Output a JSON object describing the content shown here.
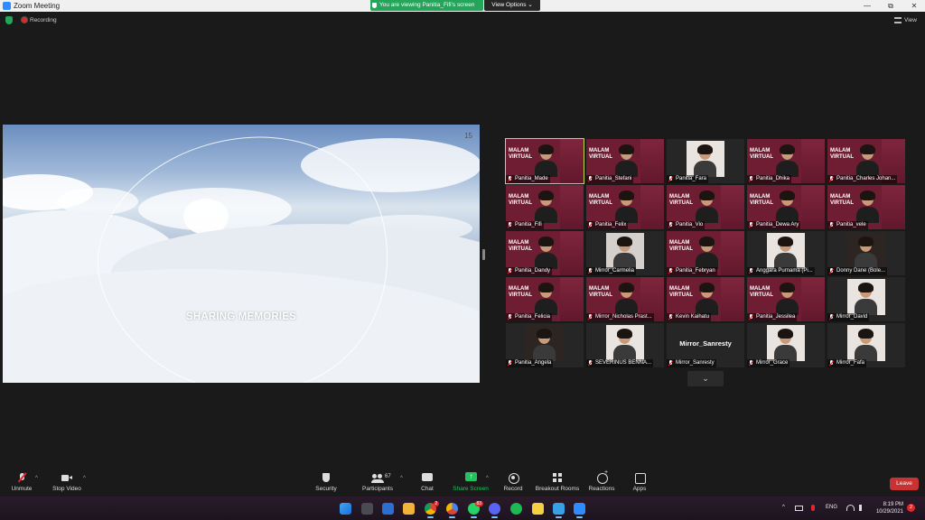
{
  "window": {
    "title": "Zoom Meeting",
    "controls": {
      "minimize": "—",
      "maximize": "⧉",
      "close": "✕"
    }
  },
  "share_banner": {
    "text": "You are viewing Panitia_Fifi's screen",
    "view_options": "View Options ⌄"
  },
  "topbar": {
    "recording": "Recording",
    "view": "View"
  },
  "shared_screen": {
    "slide_title": "SHARING MEMORIES",
    "slide_number": "15"
  },
  "gallery": {
    "tiles": [
      {
        "name": "Panitia_Made",
        "style": "maroon",
        "active": true
      },
      {
        "name": "Panitia_Stefani",
        "style": "maroon"
      },
      {
        "name": "Panitia_Fara",
        "style": "photo-light"
      },
      {
        "name": "Panitia_Dhika",
        "style": "maroon"
      },
      {
        "name": "Panitia_Charles Johan...",
        "style": "maroon"
      },
      {
        "name": "Panitia_Fifi",
        "style": "maroon"
      },
      {
        "name": "Panitia_Felix",
        "style": "maroon"
      },
      {
        "name": "Panitia_Vio",
        "style": "maroon"
      },
      {
        "name": "Panitia_Dewa Ary",
        "style": "maroon"
      },
      {
        "name": "Panitia_vele",
        "style": "maroon"
      },
      {
        "name": "Panitia_Dandy",
        "style": "maroon"
      },
      {
        "name": "Mirror_Carmelia",
        "style": "photo-wall"
      },
      {
        "name": "Panitia_Febryan",
        "style": "maroon"
      },
      {
        "name": "Anggara Purnama (Pi...",
        "style": "photo-light"
      },
      {
        "name": "Donny Dane (Bole...",
        "style": "photo-dark"
      },
      {
        "name": "Panitia_Felicia",
        "style": "maroon"
      },
      {
        "name": "Mirror_Nicholas Prast...",
        "style": "maroon"
      },
      {
        "name": "Kevin Kaihatu",
        "style": "maroon"
      },
      {
        "name": "Panitia_Jessilea",
        "style": "maroon"
      },
      {
        "name": "Mirror_David",
        "style": "photo-light"
      },
      {
        "name": "Panitia_Angela",
        "style": "photo-dark"
      },
      {
        "name": "SEVERINUS BENNA...",
        "style": "photo-light"
      },
      {
        "name": "Mirror_Sanresty",
        "style": "name-only",
        "big_name": "Mirror_Sanresty"
      },
      {
        "name": "Mirror_Grace",
        "style": "photo-light"
      },
      {
        "name": "Mirror_Fafa",
        "style": "photo-light"
      }
    ],
    "maroon_text": "MALAM\nVIRTUAL",
    "more_icon": "⌄"
  },
  "toolbar": {
    "unmute": "Unmute",
    "stop_video": "Stop Video",
    "security": "Security",
    "participants": "Participants",
    "participants_count": "67",
    "chat": "Chat",
    "share_screen": "Share Screen",
    "record": "Record",
    "breakout_rooms": "Breakout Rooms",
    "reactions": "Reactions",
    "apps": "Apps",
    "leave": "Leave",
    "caret": "^"
  },
  "taskbar": {
    "whatsapp_badge": "83",
    "chrome_badge": "2",
    "language": "ENG",
    "time": "8:19 PM",
    "date": "10/29/2021",
    "notifications": "2",
    "tray_up": "^"
  },
  "colors": {
    "accent_green": "#23a55a",
    "active_speaker": "#c4d94b",
    "leave_red": "#c83232",
    "tile_maroon": "#6e1d33"
  }
}
